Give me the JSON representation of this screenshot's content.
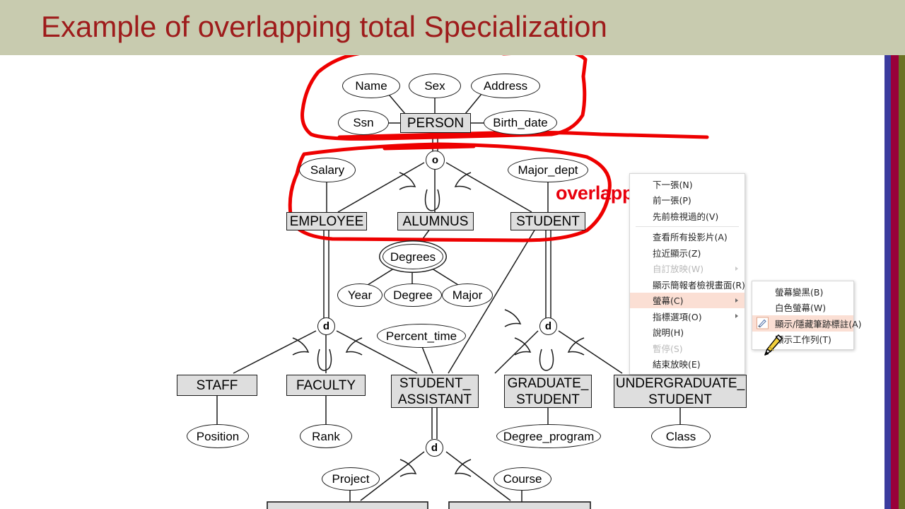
{
  "slide": {
    "title": "Example of overlapping total Specialization",
    "header_color": "#c8cbaf",
    "title_color": "#9e1b1b",
    "annotation_color": "#e8000d",
    "annotation_text": "overlapping total"
  },
  "edge_stripes": [
    {
      "name": "blue",
      "color": "#3b3b9e"
    },
    {
      "name": "crimson",
      "color": "#99003a"
    },
    {
      "name": "olive",
      "color": "#6b7224"
    }
  ],
  "diagram": {
    "type": "er-diagram",
    "entities": [
      {
        "id": "person",
        "label": "PERSON"
      },
      {
        "id": "employee",
        "label": "EMPLOYEE"
      },
      {
        "id": "alumnus",
        "label": "ALUMNUS"
      },
      {
        "id": "student",
        "label": "STUDENT"
      },
      {
        "id": "staff",
        "label": "STAFF"
      },
      {
        "id": "faculty",
        "label": "FACULTY"
      },
      {
        "id": "student_asst",
        "label": "STUDENT_\nASSISTANT"
      },
      {
        "id": "grad_student",
        "label": "GRADUATE_\nSTUDENT"
      },
      {
        "id": "undergrad",
        "label": "UNDERGRADUATE_\nSTUDENT"
      }
    ],
    "attributes": [
      {
        "id": "name",
        "label": "Name"
      },
      {
        "id": "sex",
        "label": "Sex"
      },
      {
        "id": "address",
        "label": "Address"
      },
      {
        "id": "ssn",
        "label": "Ssn"
      },
      {
        "id": "birth_date",
        "label": "Birth_date"
      },
      {
        "id": "salary",
        "label": "Salary"
      },
      {
        "id": "major_dept",
        "label": "Major_dept"
      },
      {
        "id": "degrees",
        "label": "Degrees",
        "multivalued": true
      },
      {
        "id": "year",
        "label": "Year"
      },
      {
        "id": "degree",
        "label": "Degree"
      },
      {
        "id": "major",
        "label": "Major"
      },
      {
        "id": "percent_time",
        "label": "Percent_time"
      },
      {
        "id": "position",
        "label": "Position"
      },
      {
        "id": "rank",
        "label": "Rank"
      },
      {
        "id": "degree_program",
        "label": "Degree_program"
      },
      {
        "id": "class",
        "label": "Class"
      },
      {
        "id": "project",
        "label": "Project"
      },
      {
        "id": "course",
        "label": "Course"
      }
    ],
    "specialization_circles": [
      {
        "id": "o-person",
        "label": "o"
      },
      {
        "id": "d-employee",
        "label": "d"
      },
      {
        "id": "d-student",
        "label": "d"
      },
      {
        "id": "d-asst",
        "label": "d"
      }
    ]
  },
  "context_menu": {
    "items": [
      {
        "label": "下一張(N)",
        "mnemonic": "N",
        "disabled": false,
        "submenu": false,
        "highlighted": false
      },
      {
        "label": "前一張(P)",
        "mnemonic": "P",
        "disabled": false,
        "submenu": false,
        "highlighted": false
      },
      {
        "label": "先前檢視過的(V)",
        "mnemonic": "V",
        "disabled": false,
        "submenu": false,
        "highlighted": false
      },
      {
        "separator": true
      },
      {
        "label": "查看所有投影片(A)",
        "mnemonic": "A",
        "disabled": false,
        "submenu": false,
        "highlighted": false
      },
      {
        "label": "拉近顯示(Z)",
        "mnemonic": "Z",
        "disabled": false,
        "submenu": false,
        "highlighted": false
      },
      {
        "label": "自訂放映(W)",
        "mnemonic": "W",
        "disabled": true,
        "submenu": true,
        "highlighted": false
      },
      {
        "label": "顯示簡報者檢視畫面(R)",
        "mnemonic": "R",
        "disabled": false,
        "submenu": false,
        "highlighted": false
      },
      {
        "label": "螢幕(C)",
        "mnemonic": "C",
        "disabled": false,
        "submenu": true,
        "highlighted": true
      },
      {
        "label": "指標選項(O)",
        "mnemonic": "O",
        "disabled": false,
        "submenu": true,
        "highlighted": false
      },
      {
        "label": "說明(H)",
        "mnemonic": "H",
        "disabled": false,
        "submenu": false,
        "highlighted": false
      },
      {
        "label": "暫停(S)",
        "mnemonic": "S",
        "disabled": true,
        "submenu": false,
        "highlighted": false
      },
      {
        "label": "結束放映(E)",
        "mnemonic": "E",
        "disabled": false,
        "submenu": false,
        "highlighted": false
      }
    ]
  },
  "submenu": {
    "items": [
      {
        "label": "螢幕變黑(B)",
        "mnemonic": "B",
        "disabled": false,
        "highlighted": false,
        "icon": null
      },
      {
        "label": "白色螢幕(W)",
        "mnemonic": "W",
        "disabled": false,
        "highlighted": false,
        "icon": null
      },
      {
        "label": "顯示/隱藏筆跡標註(A)",
        "mnemonic": "A",
        "disabled": false,
        "highlighted": true,
        "icon": "ink-annotation-icon"
      },
      {
        "label": "顯示工作列(T)",
        "mnemonic": "T",
        "disabled": false,
        "highlighted": false,
        "icon": null
      }
    ]
  },
  "cursor": {
    "icon": "pen-cursor-icon"
  }
}
